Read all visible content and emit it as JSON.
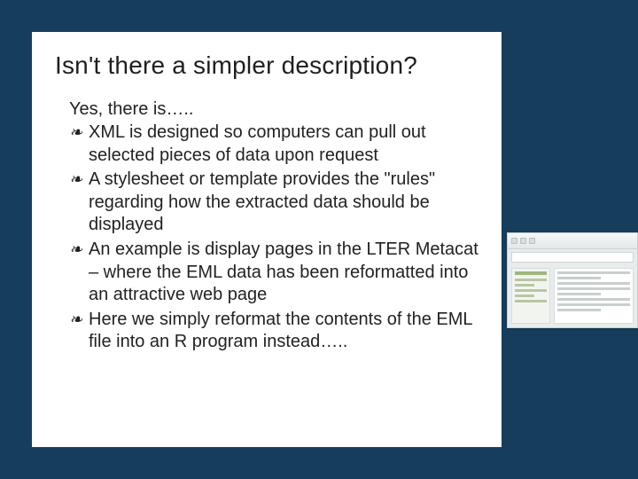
{
  "slide": {
    "title": "Isn't there a simpler description?",
    "intro": "Yes, there is…..",
    "bullet_glyph": "❧",
    "bullets": [
      "XML is designed so computers can pull out selected pieces of data upon request",
      "A stylesheet or template provides the \"rules\" regarding how the extracted data should be displayed",
      "An example is display pages in the LTER Metacat – where the EML data has been reformatted into an attractive web page",
      "Here we simply reformat the contents of the EML file into an R program instead….."
    ]
  }
}
